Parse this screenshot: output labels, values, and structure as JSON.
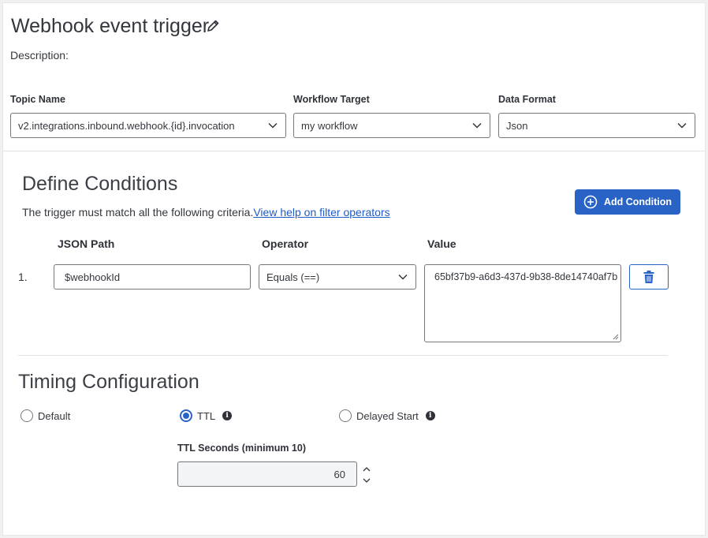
{
  "header": {
    "title": "Webhook event trigger",
    "description_label": "Description:"
  },
  "fields": {
    "topic_name": {
      "label": "Topic Name",
      "value": "v2.integrations.inbound.webhook.{id}.invocation"
    },
    "workflow_target": {
      "label": "Workflow Target",
      "value": "my workflow"
    },
    "data_format": {
      "label": "Data Format",
      "value": "Json"
    }
  },
  "conditions": {
    "title": "Define Conditions",
    "criteria_text": "The trigger must match all the following criteria.",
    "help_link": "View help on filter operators",
    "add_button": "Add Condition",
    "columns": {
      "json_path": "JSON Path",
      "operator": "Operator",
      "value": "Value"
    },
    "rows": [
      {
        "index": "1.",
        "json_path": "$webhookId",
        "operator": "Equals (==)",
        "value": "65bf37b9-a6d3-437d-9b38-8de14740af7b"
      }
    ]
  },
  "timing": {
    "title": "Timing Configuration",
    "options": [
      {
        "label": "Default",
        "selected": false
      },
      {
        "label": "TTL",
        "selected": true
      },
      {
        "label": "Delayed Start",
        "selected": false
      }
    ],
    "ttl_label": "TTL Seconds (minimum 10)",
    "ttl_value": "60"
  },
  "colors": {
    "accent": "#2a63c6",
    "link": "#1e5bc6",
    "border": "#75787d"
  },
  "icons": [
    "pencil-icon",
    "chevron-down-icon",
    "plus-circle-icon",
    "trash-icon",
    "info-icon",
    "stepper-icon",
    "resize-handle-icon"
  ]
}
